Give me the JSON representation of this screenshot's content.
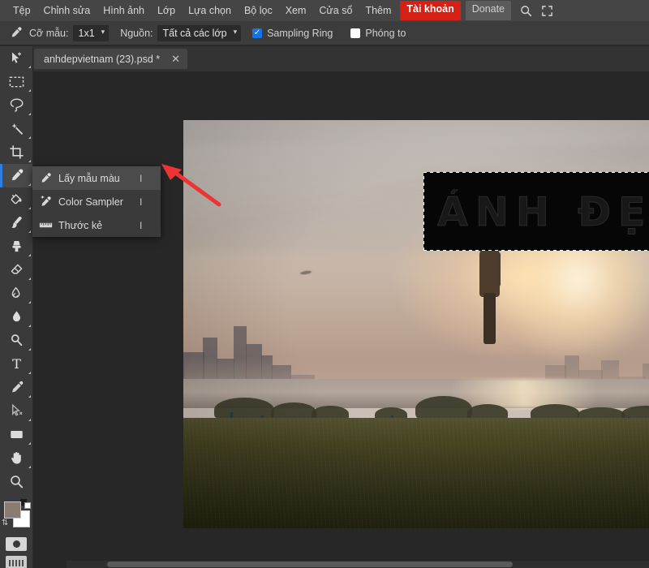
{
  "menubar": {
    "items": [
      {
        "label": "Tệp",
        "kind": "plain",
        "name": "menu-file"
      },
      {
        "label": "Chỉnh sửa",
        "kind": "plain",
        "name": "menu-edit"
      },
      {
        "label": "Hình ảnh",
        "kind": "plain",
        "name": "menu-image"
      },
      {
        "label": "Lớp",
        "kind": "plain",
        "name": "menu-layer"
      },
      {
        "label": "Lựa chọn",
        "kind": "plain",
        "name": "menu-select"
      },
      {
        "label": "Bộ lọc",
        "kind": "plain",
        "name": "menu-filter"
      },
      {
        "label": "Xem",
        "kind": "plain",
        "name": "menu-view"
      },
      {
        "label": "Cửa sổ",
        "kind": "plain",
        "name": "menu-window"
      },
      {
        "label": "Thêm",
        "kind": "plain",
        "name": "menu-more"
      },
      {
        "label": "Tài khoản",
        "kind": "account",
        "name": "menu-account"
      },
      {
        "label": "Donate",
        "kind": "donate",
        "name": "menu-donate"
      }
    ],
    "search_icon": "search-icon",
    "fullscreen_icon": "fullscreen-icon",
    "accent_color": "#d81f13",
    "background_color": "#454545"
  },
  "optionsbar": {
    "tool_icon": "eyedropper-icon",
    "sample_size_label": "Cỡ mẫu:",
    "sample_size_value": "1x1",
    "source_label": "Nguồn:",
    "source_value": "Tất cả các lớp",
    "caret": "˅",
    "checkboxes": [
      {
        "label": "Sampling Ring",
        "checked": true,
        "name": "checkbox-sampling-ring"
      },
      {
        "label": "Phóng to",
        "checked": false,
        "name": "checkbox-zoom"
      }
    ],
    "checked_color": "#1473e6"
  },
  "tabbar": {
    "document_name": "anhdepvietnam (23).psd *",
    "close_glyph": "✕"
  },
  "toolbar": {
    "tools": [
      {
        "name": "move-tool",
        "icon": "move-arrow-icon",
        "selected": false,
        "has_flyout": true
      },
      {
        "name": "marquee-tool",
        "icon": "rectangular-marquee-icon",
        "selected": false,
        "has_flyout": true
      },
      {
        "name": "lasso-tool",
        "icon": "lasso-icon",
        "selected": false,
        "has_flyout": true
      },
      {
        "name": "magic-wand-tool",
        "icon": "magic-wand-icon",
        "selected": false,
        "has_flyout": true
      },
      {
        "name": "crop-tool",
        "icon": "crop-icon",
        "selected": false,
        "has_flyout": true
      },
      {
        "name": "eyedropper-tool",
        "icon": "eyedropper-icon",
        "selected": true,
        "has_flyout": true
      },
      {
        "name": "paint-bucket-tool",
        "icon": "paint-bucket-icon",
        "selected": false,
        "has_flyout": true
      },
      {
        "name": "brush-tool",
        "icon": "brush-icon",
        "selected": false,
        "has_flyout": true
      },
      {
        "name": "clone-stamp-tool",
        "icon": "clone-stamp-icon",
        "selected": false,
        "has_flyout": true
      },
      {
        "name": "eraser-tool",
        "icon": "eraser-icon",
        "selected": false,
        "has_flyout": true
      },
      {
        "name": "gradient-tool",
        "icon": "gradient-icon",
        "selected": false,
        "has_flyout": true
      },
      {
        "name": "blur-tool",
        "icon": "blur-droplet-icon",
        "selected": false,
        "has_flyout": true
      },
      {
        "name": "dodge-tool",
        "icon": "dodge-icon",
        "selected": false,
        "has_flyout": true
      },
      {
        "name": "type-tool",
        "icon": "type-t-icon",
        "selected": false,
        "has_flyout": true
      },
      {
        "name": "pen-tool",
        "icon": "pen-icon",
        "selected": false,
        "has_flyout": true
      },
      {
        "name": "path-select-tool",
        "icon": "path-select-arrow-icon",
        "selected": false,
        "has_flyout": true
      },
      {
        "name": "shape-tool",
        "icon": "rectangle-shape-icon",
        "selected": false,
        "has_flyout": true
      },
      {
        "name": "hand-tool",
        "icon": "hand-icon",
        "selected": false,
        "has_flyout": true
      },
      {
        "name": "zoom-tool",
        "icon": "magnifier-icon",
        "selected": false,
        "has_flyout": false
      }
    ],
    "foreground_color": "#8a7c73",
    "background_color": "#ffffff",
    "swap_icon": "swap-colors-icon",
    "quickmask_icon": "quick-mask-icon",
    "screenmode_icon": "screen-mode-icon"
  },
  "flyout": {
    "items": [
      {
        "label": "Lấy mẫu màu",
        "shortcut": "I",
        "icon": "eyedropper-icon",
        "highlighted": true,
        "name": "flyout-item-eyedropper"
      },
      {
        "label": "Color Sampler",
        "shortcut": "I",
        "icon": "color-sampler-icon",
        "highlighted": false,
        "name": "flyout-item-color-sampler"
      },
      {
        "label": "Thước kẻ",
        "shortcut": "I",
        "icon": "ruler-icon",
        "highlighted": false,
        "name": "flyout-item-ruler"
      }
    ]
  },
  "annotation": {
    "arrow_color": "#ee3333",
    "arrow_name": "red-pointer-arrow"
  },
  "canvas": {
    "background_color": "#272727",
    "selection": {
      "ghost_text": "ẢNH ĐẸP VIỆT NAM",
      "fill_color": "#060606",
      "marching_ants": true
    },
    "photo_description": "sunset-silhouette-photo"
  }
}
